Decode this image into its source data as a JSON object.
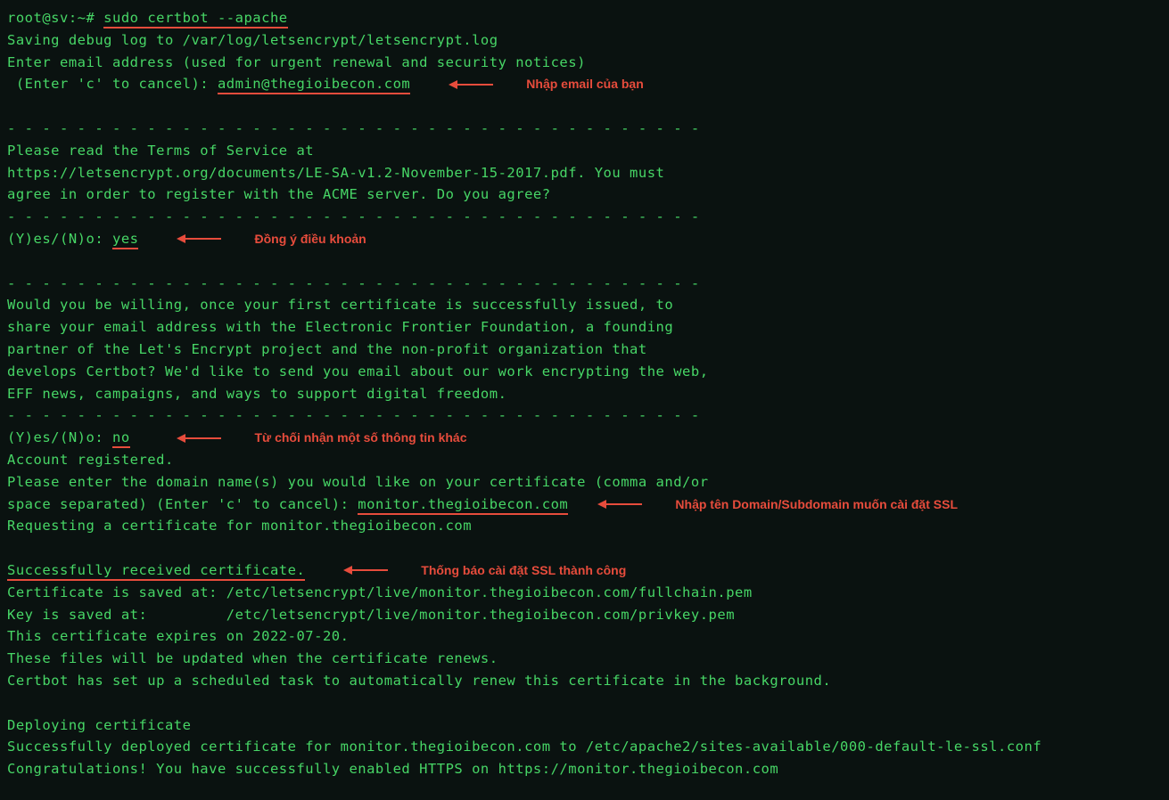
{
  "prompt": "root@sv:~# ",
  "cmd": "sudo certbot --apache",
  "l1": "Saving debug log to /var/log/letsencrypt/letsencrypt.log",
  "l2": "Enter email address (used for urgent renewal and security notices)",
  "l3a": " (Enter 'c' to cancel): ",
  "email": "admin@thegioibecon.com",
  "a1": "Nhập email của bạn",
  "dash": "- - - - - - - - - - - - - - - - - - - - - - - - - - - - - - - - - - - - - - - -",
  "l4": "Please read the Terms of Service at",
  "l5": "https://letsencrypt.org/documents/LE-SA-v1.2-November-15-2017.pdf. You must",
  "l6": "agree in order to register with the ACME server. Do you agree?",
  "yn": "(Y)es/(N)o: ",
  "yes": "yes",
  "a2": "Đồng ý điều khoản",
  "l7": "Would you be willing, once your first certificate is successfully issued, to",
  "l8": "share your email address with the Electronic Frontier Foundation, a founding",
  "l9": "partner of the Let's Encrypt project and the non-profit organization that",
  "l10": "develops Certbot? We'd like to send you email about our work encrypting the web,",
  "l11": "EFF news, campaigns, and ways to support digital freedom.",
  "no": "no",
  "a3": "Từ chối nhận một số thông tin khác",
  "l12": "Account registered.",
  "l13": "Please enter the domain name(s) you would like on your certificate (comma and/or",
  "l14a": "space separated) (Enter 'c' to cancel): ",
  "domain": "monitor.thegioibecon.com",
  "a4": "Nhập tên Domain/Subdomain muốn cài đặt SSL",
  "l15": "Requesting a certificate for monitor.thegioibecon.com",
  "success": "Successfully received certificate.",
  "a5": "Thống báo cài đặt SSL thành công",
  "l16": "Certificate is saved at: /etc/letsencrypt/live/monitor.thegioibecon.com/fullchain.pem",
  "l17": "Key is saved at:         /etc/letsencrypt/live/monitor.thegioibecon.com/privkey.pem",
  "l18": "This certificate expires on 2022-07-20.",
  "l19": "These files will be updated when the certificate renews.",
  "l20": "Certbot has set up a scheduled task to automatically renew this certificate in the background.",
  "l21": "Deploying certificate",
  "l22": "Successfully deployed certificate for monitor.thegioibecon.com to /etc/apache2/sites-available/000-default-le-ssl.conf",
  "l23": "Congratulations! You have successfully enabled HTTPS on https://monitor.thegioibecon.com"
}
